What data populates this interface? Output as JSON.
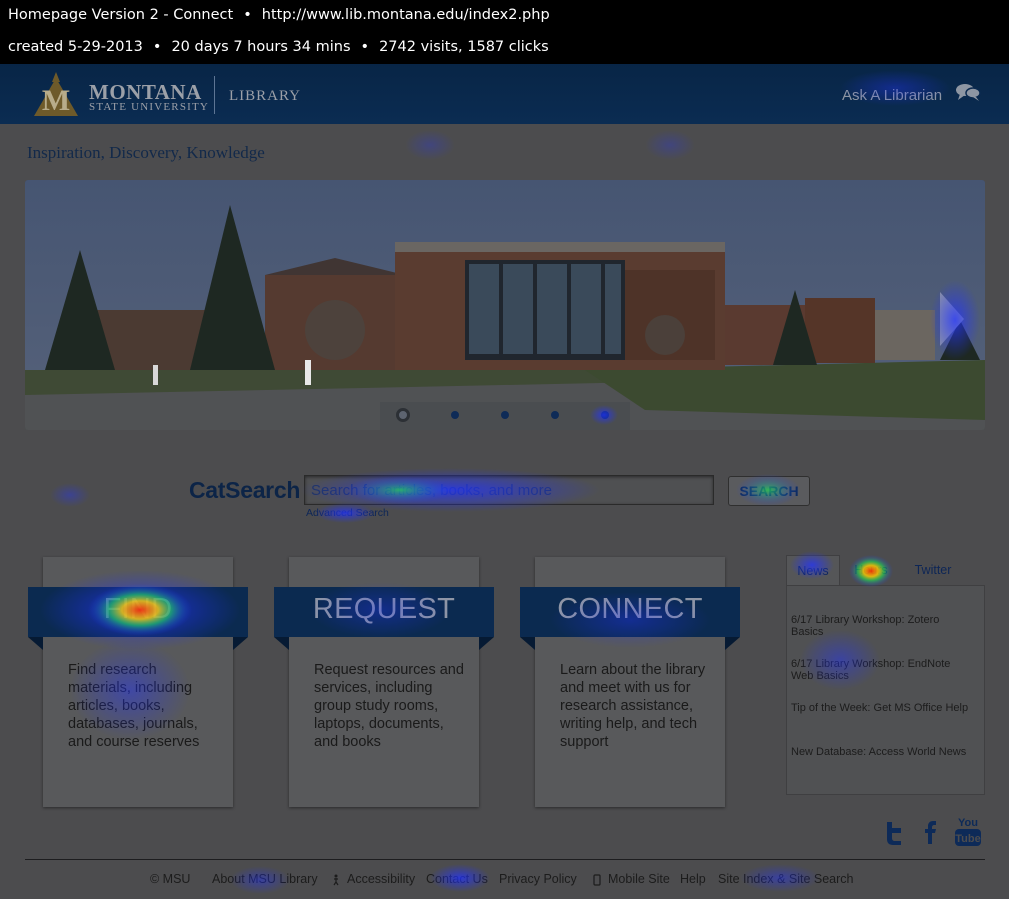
{
  "meta": {
    "title": "Homepage Version 2 - Connect",
    "url": "http://www.lib.montana.edu/index2.php",
    "created": "created 5-29-2013",
    "duration": "20 days 7 hours 34 mins",
    "stats": "2742 visits, 1587 clicks",
    "separator": "•"
  },
  "header": {
    "logo_montana": "MONTANA",
    "logo_msu": "STATE UNIVERSITY",
    "logo_library": "LIBRARY",
    "ask_librarian": "Ask A Librarian"
  },
  "tagline": "Inspiration, Discovery, Knowledge",
  "search": {
    "label": "CatSearch",
    "placeholder": "Search for articles, books, and more",
    "button": "SEARCH",
    "advanced": "Advanced Search"
  },
  "cards": [
    {
      "title": "FIND",
      "desc": "Find research materials, including articles, books, databases, journals, and course reserves"
    },
    {
      "title": "REQUEST",
      "desc": "Request resources and services, including group study rooms, laptops, documents, and books"
    },
    {
      "title": "CONNECT",
      "desc": "Learn about the library and meet with us for research assistance, writing help, and tech support"
    }
  ],
  "tabs": {
    "labels": [
      "News",
      "Hours",
      "Twitter"
    ],
    "items": [
      "6/17 Library Workshop: Zotero Basics",
      "6/17 Library Workshop: EndNote Web Basics",
      "Tip of the Week: Get MS Office Help",
      "New Database: Access World News"
    ]
  },
  "social": {
    "youtube_you": "You",
    "youtube_tube": "Tube"
  },
  "footer": {
    "links": [
      "© MSU",
      "About MSU Library",
      "Accessibility",
      "Contact Us",
      "Privacy Policy",
      "Mobile Site",
      "Help",
      "Site Index & Site Search"
    ]
  },
  "colors": {
    "header_bg": "#0b2a50",
    "heatmap_low": "#1a2cff",
    "heatmap_mid": "#00ff40",
    "heatmap_high": "#ff2000"
  }
}
